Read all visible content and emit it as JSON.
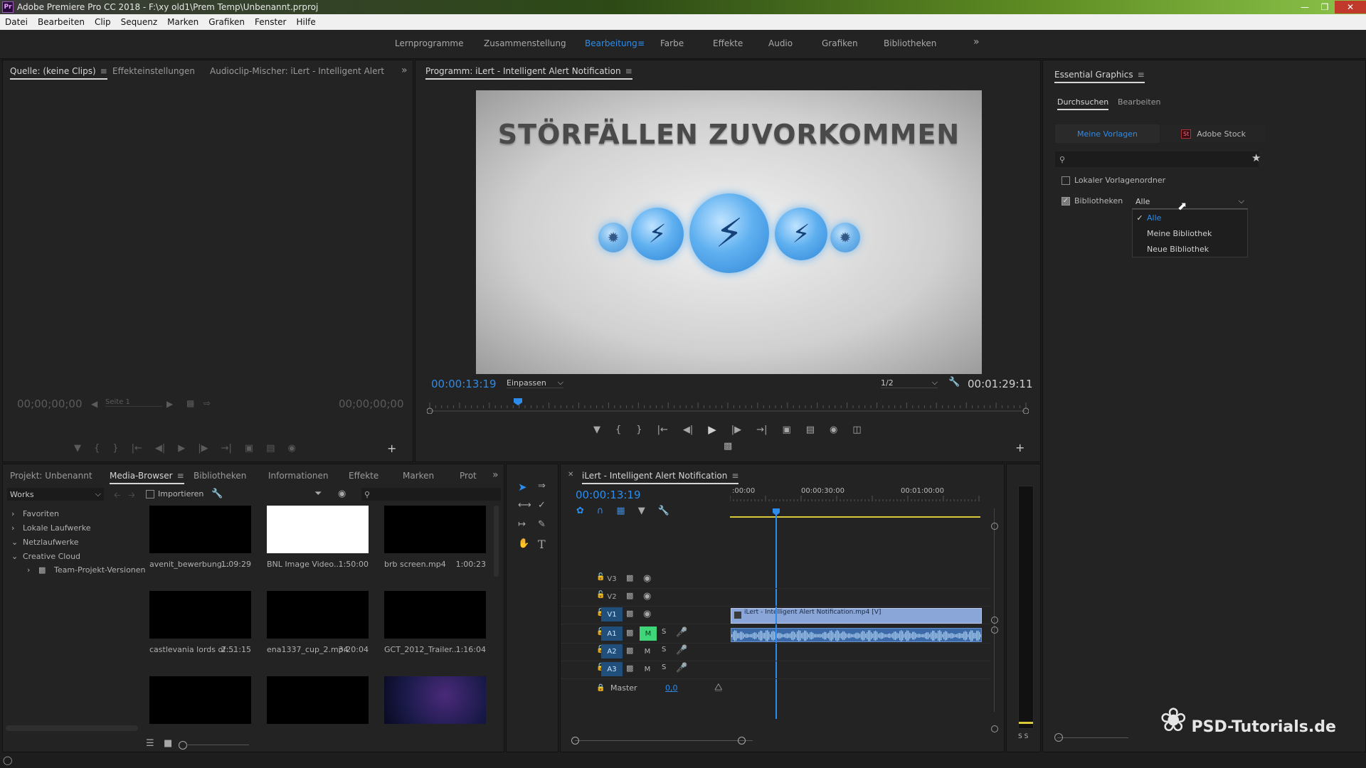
{
  "window": {
    "title": "Adobe Premiere Pro CC 2018 - F:\\xy old1\\Prem Temp\\Unbenannt.prproj",
    "app_badge": "Pr"
  },
  "menu": [
    "Datei",
    "Bearbeiten",
    "Clip",
    "Sequenz",
    "Marken",
    "Grafiken",
    "Fenster",
    "Hilfe"
  ],
  "workspaces": {
    "tabs": [
      "Lernprogramme",
      "Zusammenstellung",
      "Bearbeitung",
      "Farbe",
      "Effekte",
      "Audio",
      "Grafiken",
      "Bibliotheken"
    ],
    "active": "Bearbeitung"
  },
  "source_panel": {
    "tabs": [
      "Quelle: (keine Clips)",
      "Effekteinstellungen",
      "Audioclip-Mischer: iLert - Intelligent Alert Notificati"
    ],
    "tc_left": "00;00;00;00",
    "tc_right": "00;00;00;00",
    "page_select": "Seite 1"
  },
  "program_panel": {
    "title": "Programm: iLert - Intelligent Alert Notification",
    "video_title": "STÖRFÄLLEN ZUVORKOMMEN",
    "timecode": "00:00:13:19",
    "fit": "Einpassen",
    "resolution": "1/2",
    "duration": "00:01:29:11",
    "playhead_fraction": 0.148
  },
  "essential_graphics": {
    "title": "Essential Graphics",
    "tabs": [
      "Durchsuchen",
      "Bearbeiten"
    ],
    "active_tab": "Durchsuchen",
    "sources": [
      "Meine Vorlagen",
      "Adobe Stock"
    ],
    "stock_badge": "St",
    "search_placeholder": "",
    "local_folder_label": "Lokaler Vorlagenordner",
    "local_folder_checked": false,
    "libraries_label": "Bibliotheken",
    "libraries_checked": true,
    "libraries_value": "Alle",
    "dropdown_options": [
      "Alle",
      "Meine Bibliothek",
      "Neue Bibliothek"
    ],
    "dropdown_selected": "Alle",
    "accent": "#2d8ceb"
  },
  "project_panel": {
    "tabs": [
      "Projekt: Unbenannt",
      "Media-Browser",
      "Bibliotheken",
      "Informationen",
      "Effekte",
      "Marken",
      "Prot"
    ],
    "active": "Media-Browser",
    "location": "Works",
    "import_label": "Importieren",
    "tree": [
      "Favoriten",
      "Lokale Laufwerke",
      "Netzlaufwerke",
      "Creative Cloud",
      "Team-Projekt-Versionen"
    ],
    "thumbnails": [
      {
        "name": "avenit_bewerbung...",
        "dur": "1:09:29",
        "style": "black"
      },
      {
        "name": "BNL Image Video...",
        "dur": "1:50:00",
        "style": "white"
      },
      {
        "name": "brb screen.mp4",
        "dur": "1:00:23",
        "style": "black"
      },
      {
        "name": "castlevania lords of ...",
        "dur": "2:51:15",
        "style": "black"
      },
      {
        "name": "ena1337_cup_2.mp4",
        "dur": "3:20:04",
        "style": "black"
      },
      {
        "name": "GCT_2012_Trailer...",
        "dur": "1:16:04",
        "style": "black"
      },
      {
        "name": "",
        "dur": "",
        "style": "black"
      },
      {
        "name": "",
        "dur": "",
        "style": "black"
      },
      {
        "name": "",
        "dur": "",
        "style": "space"
      }
    ]
  },
  "timeline": {
    "sequence_name": "iLert - Intelligent Alert Notification",
    "timecode": "00:00:13:19",
    "ruler": [
      ":00:00",
      "00:00:30:00",
      "00:01:00:00"
    ],
    "video_tracks": [
      "V3",
      "V2",
      "V1"
    ],
    "audio_tracks": [
      "A1",
      "A2",
      "A3"
    ],
    "master_label": "Master",
    "master_value": "0,0",
    "video_clip": "iLert - Intelligent Alert Notification.mp4 [V]",
    "mute_label": "M",
    "solo_label": "S"
  },
  "meter": {
    "labels": "S S"
  },
  "watermark": {
    "text": "PSD-Tutorials.de"
  }
}
